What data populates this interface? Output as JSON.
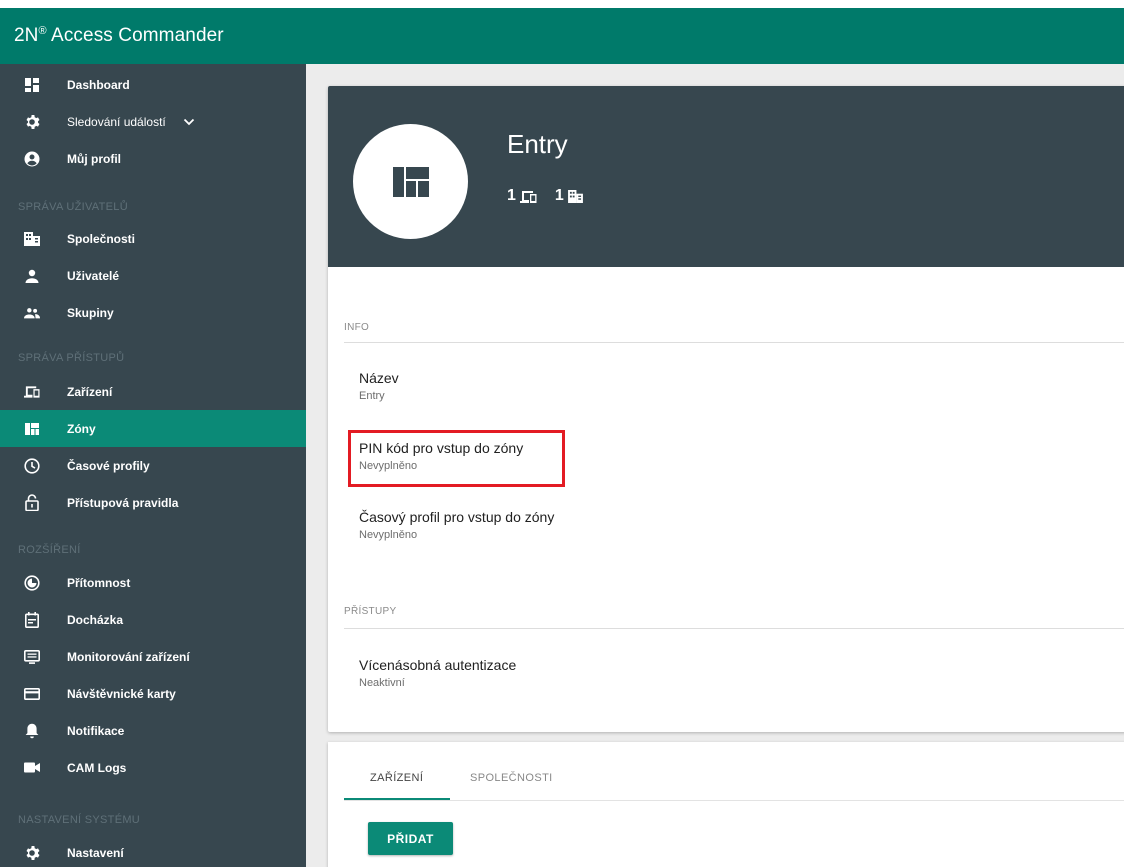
{
  "app": {
    "title": "2N",
    "title_sup": "®",
    "title_rest": " Access Commander"
  },
  "sidebar": {
    "items_top": [
      {
        "label": "Dashboard",
        "icon": "dashboard-icon"
      },
      {
        "label": "Sledování událostí",
        "icon": "gear-icon"
      },
      {
        "label": "Můj profil",
        "icon": "account-circle-icon"
      }
    ],
    "section_users": "SPRÁVA UŽIVATELŮ",
    "items_users": [
      {
        "label": "Společnosti",
        "icon": "company-icon"
      },
      {
        "label": "Uživatelé",
        "icon": "user-icon"
      },
      {
        "label": "Skupiny",
        "icon": "group-icon"
      }
    ],
    "section_access": "SPRÁVA PŘÍSTUPŮ",
    "items_access": [
      {
        "label": "Zařízení",
        "icon": "devices-icon"
      },
      {
        "label": "Zóny",
        "icon": "zones-icon"
      },
      {
        "label": "Časové profily",
        "icon": "clock-icon"
      },
      {
        "label": "Přístupová pravidla",
        "icon": "lock-icon"
      }
    ],
    "section_ext": "ROZŠÍŘENÍ",
    "items_ext": [
      {
        "label": "Přítomnost",
        "icon": "presence-icon"
      },
      {
        "label": "Docházka",
        "icon": "attendance-icon"
      },
      {
        "label": "Monitorování zařízení",
        "icon": "monitor-icon"
      },
      {
        "label": "Návštěvnické karty",
        "icon": "card-icon"
      },
      {
        "label": "Notifikace",
        "icon": "bell-icon"
      },
      {
        "label": "CAM Logs",
        "icon": "camera-icon"
      }
    ],
    "section_system": "NASTAVENÍ SYSTÉMU",
    "items_system": [
      {
        "label": "Nastavení",
        "icon": "gear-icon"
      }
    ],
    "active": "Zóny",
    "colors": {
      "bg": "#37474f",
      "active": "#0b8a77",
      "appbar": "#007a6a"
    }
  },
  "zone": {
    "title": "Entry",
    "device_count": "1",
    "company_count": "1"
  },
  "info": {
    "section": "INFO",
    "name_label": "Název",
    "name_value": "Entry",
    "pin_label": "PIN kód pro vstup do zóny",
    "pin_value": "Nevyplněno",
    "time_label": "Časový profil pro vstup do zóny",
    "time_value": "Nevyplněno"
  },
  "access": {
    "section": "PŘÍSTUPY",
    "mfa_label": "Vícenásobná autentizace",
    "mfa_value": "Neaktivní"
  },
  "tabs": {
    "devices": "ZAŘÍZENÍ",
    "companies": "SPOLEČNOSTI",
    "active": "ZAŘÍZENÍ"
  },
  "actions": {
    "add_label": "PŘIDAT"
  }
}
